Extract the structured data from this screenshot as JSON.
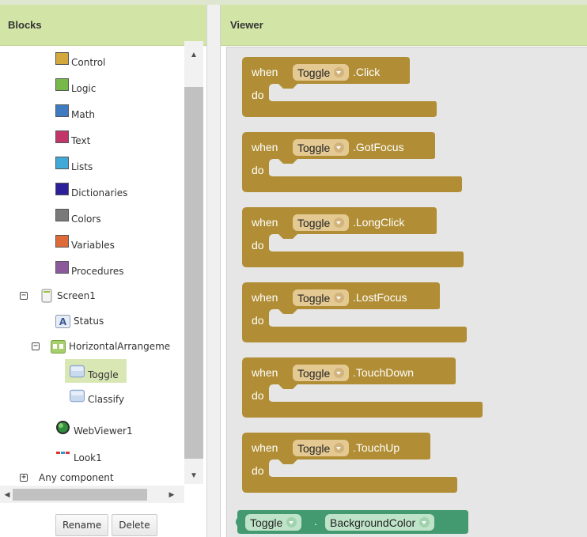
{
  "panels": {
    "blocks_title": "Blocks",
    "viewer_title": "Viewer"
  },
  "builtin": [
    {
      "label": "Control",
      "color": "#d3a93e"
    },
    {
      "label": "Logic",
      "color": "#77b84a"
    },
    {
      "label": "Math",
      "color": "#3e7bc0"
    },
    {
      "label": "Text",
      "color": "#c3366a"
    },
    {
      "label": "Lists",
      "color": "#41a9d8"
    },
    {
      "label": "Dictionaries",
      "color": "#2d1e9a"
    },
    {
      "label": "Colors",
      "color": "#7a7a7a"
    },
    {
      "label": "Variables",
      "color": "#e0693a"
    },
    {
      "label": "Procedures",
      "color": "#8c5a9c"
    }
  ],
  "components": {
    "screen": "Screen1",
    "status": "Status",
    "arrangement": "HorizontalArrangeme",
    "toggle": "Toggle",
    "classify": "Classify",
    "webviewer": "WebViewer1",
    "look": "Look1",
    "any": "Any component"
  },
  "buttons": {
    "rename": "Rename",
    "delete": "Delete"
  },
  "blocks": {
    "when": "when",
    "do": "do",
    "component": "Toggle",
    "events": [
      ".Click",
      ".GotFocus",
      ".LongClick",
      ".LostFocus",
      ".TouchDown",
      ".TouchUp"
    ],
    "getter": {
      "component": "Toggle",
      "dot": ".",
      "property": "BackgroundColor"
    }
  },
  "colors": {
    "event_block": "#b18e35",
    "getter_block": "#439970",
    "header": "#d2e4a6"
  }
}
